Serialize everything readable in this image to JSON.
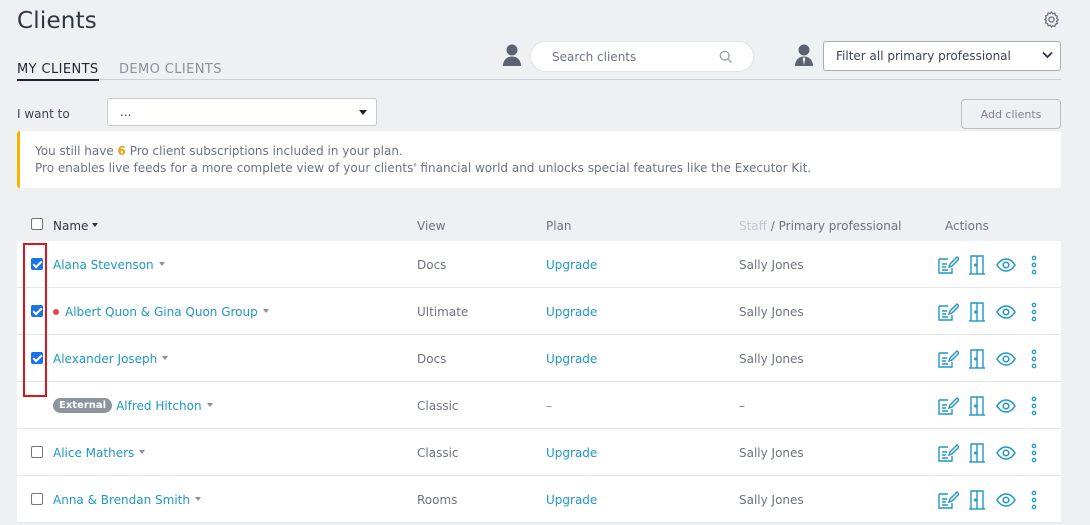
{
  "page": {
    "title": "Clients"
  },
  "tabs": [
    {
      "label": "MY CLIENTS",
      "active": true
    },
    {
      "label": "DEMO CLIENTS",
      "active": false
    }
  ],
  "search": {
    "placeholder": "Search clients",
    "value": ""
  },
  "filter": {
    "value": "Filter all primary professional"
  },
  "bulk": {
    "label": "I want to",
    "value": "..."
  },
  "add_clients_label": "Add clients",
  "banner": {
    "line1_pre": "You still have ",
    "count": "6",
    "line1_post": " Pro client subscriptions included in your plan.",
    "line2": "Pro enables live feeds for a more complete view of your clients' financial world and unlocks special features like the Executor Kit."
  },
  "table": {
    "headers": {
      "name": "Name",
      "view": "View",
      "plan": "Plan",
      "staff_muted": "Staff",
      "staff_rest": " / Primary professional",
      "actions": "Actions"
    },
    "rows": [
      {
        "checked": true,
        "badge": "",
        "dot": false,
        "name": "Alana Stevenson",
        "view": "Docs",
        "plan": "Upgrade",
        "staff": "Sally Jones"
      },
      {
        "checked": true,
        "badge": "",
        "dot": true,
        "name": "Albert Quon & Gina Quon Group",
        "view": "Ultimate",
        "plan": "Upgrade",
        "staff": "Sally Jones"
      },
      {
        "checked": true,
        "badge": "",
        "dot": false,
        "name": "Alexander Joseph",
        "view": "Docs",
        "plan": "Upgrade",
        "staff": "Sally Jones"
      },
      {
        "checked": null,
        "badge": "External",
        "dot": false,
        "name": "Alfred Hitchon",
        "view": "Classic",
        "plan": "–",
        "staff": "–"
      },
      {
        "checked": false,
        "badge": "",
        "dot": false,
        "name": "Alice Mathers",
        "view": "Classic",
        "plan": "Upgrade",
        "staff": "Sally Jones"
      },
      {
        "checked": false,
        "badge": "",
        "dot": false,
        "name": "Anna & Brendan Smith",
        "view": "Rooms",
        "plan": "Upgrade",
        "staff": "Sally Jones"
      }
    ]
  },
  "colors": {
    "accent": "#1f97c7",
    "warning": "#f4b400",
    "highlight": "#e1141b",
    "checkbox": "#1a73e8"
  },
  "icons": [
    "settings-gear-icon",
    "person-icon",
    "search-icon",
    "professional-person-icon",
    "chevron-down-icon",
    "edit-document-icon",
    "door-icon",
    "eye-icon",
    "more-vertical-icon"
  ]
}
